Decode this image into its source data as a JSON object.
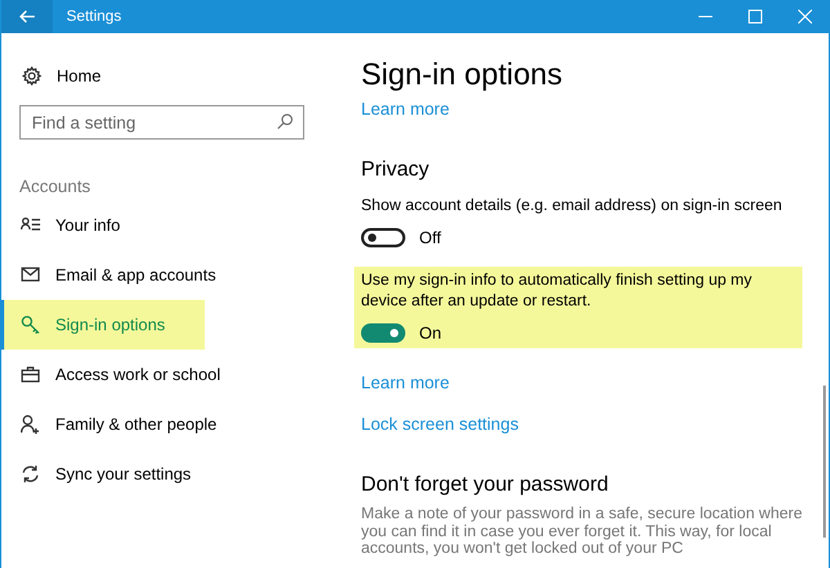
{
  "window": {
    "title": "Settings"
  },
  "sidebar": {
    "home": "Home",
    "search": {
      "placeholder": "Find a setting"
    },
    "section": "Accounts",
    "items": [
      {
        "label": "Your info",
        "selected": false
      },
      {
        "label": "Email & app accounts",
        "selected": false
      },
      {
        "label": "Sign-in options",
        "selected": true
      },
      {
        "label": "Access work or school",
        "selected": false
      },
      {
        "label": "Family & other people",
        "selected": false
      },
      {
        "label": "Sync your settings",
        "selected": false
      }
    ]
  },
  "content": {
    "title": "Sign-in options",
    "blocks": [
      {
        "kind": "link",
        "text": "Learn more"
      },
      {
        "kind": "heading",
        "text": "Privacy"
      },
      {
        "kind": "setting",
        "label": "Show account details (e.g. email address) on sign-in screen",
        "on": false,
        "state_label": "Off"
      },
      {
        "kind": "setting",
        "label": "Use my sign-in info to automatically finish setting up my device after an update or restart.",
        "on": true,
        "state_label": "On",
        "highlighted": true
      },
      {
        "kind": "link",
        "text": "Learn more"
      },
      {
        "kind": "link",
        "text": "Lock screen settings"
      },
      {
        "kind": "heading",
        "text": "Don't forget your password"
      },
      {
        "kind": "paragraph",
        "text": "Make a note of your password in a safe, secure location where you can find it in case you ever forget it. This way, for local accounts, you won't get locked out of your PC"
      }
    ]
  }
}
